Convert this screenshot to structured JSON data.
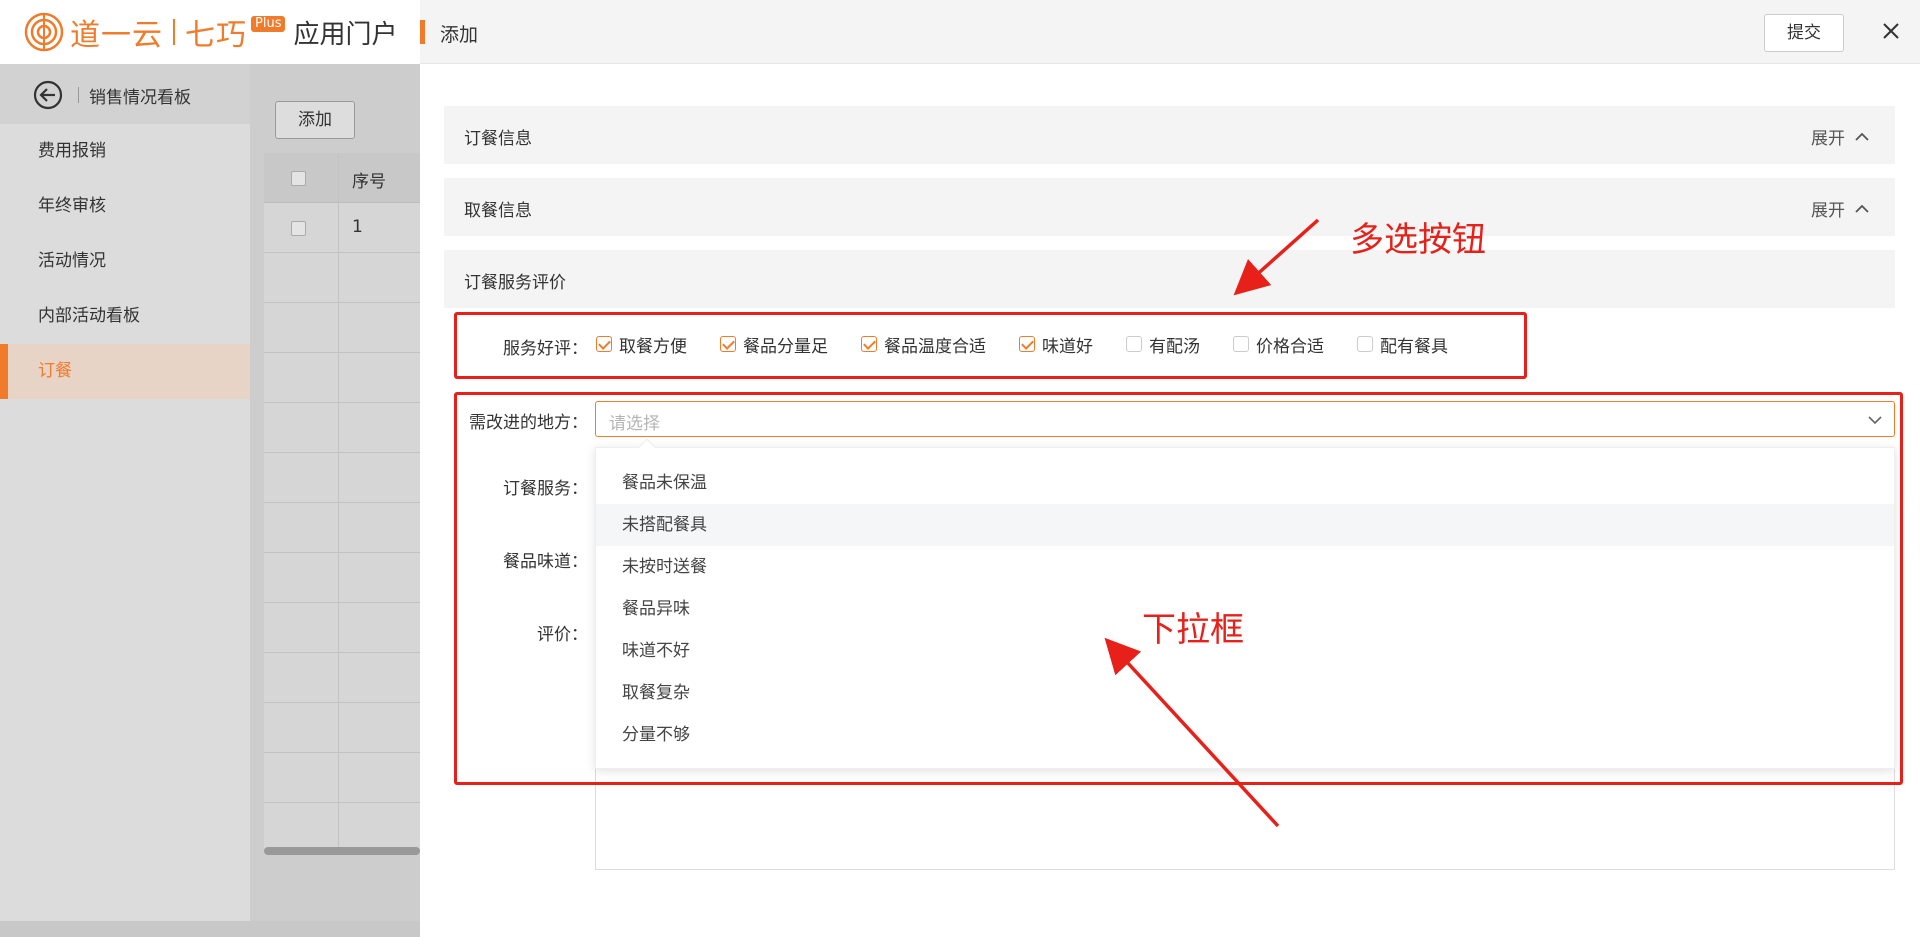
{
  "app": {
    "brand_name": "道一云",
    "brand_sub": "七巧",
    "brand_plus": "Plus",
    "portal_title": "应用门户"
  },
  "sidebar": {
    "header_title": "销售情况看板",
    "items": [
      {
        "label": "费用报销"
      },
      {
        "label": "年终审核"
      },
      {
        "label": "活动情况"
      },
      {
        "label": "内部活动看板"
      },
      {
        "label": "订餐",
        "active": true
      }
    ]
  },
  "main": {
    "add_button": "添加",
    "table": {
      "header_seq": "序号",
      "rows": [
        {
          "seq": "1"
        }
      ]
    }
  },
  "drawer": {
    "title": "添加",
    "submit_button": "提交",
    "sections": [
      {
        "title": "订餐信息",
        "toggle_label": "展开"
      },
      {
        "title": "取餐信息",
        "toggle_label": "展开"
      },
      {
        "title": "订餐服务评价"
      }
    ],
    "form": {
      "praise_label": "服务好评：",
      "praise_options": [
        {
          "label": "取餐方便",
          "checked": true
        },
        {
          "label": "餐品分量足",
          "checked": true
        },
        {
          "label": "餐品温度合适",
          "checked": true
        },
        {
          "label": "味道好",
          "checked": true
        },
        {
          "label": "有配汤",
          "checked": false
        },
        {
          "label": "价格合适",
          "checked": false
        },
        {
          "label": "配有餐具",
          "checked": false
        }
      ],
      "improve_label": "需改进的地方：",
      "improve_placeholder": "请选择",
      "improve_options": [
        {
          "label": "餐品未保温"
        },
        {
          "label": "未搭配餐具",
          "hover": true
        },
        {
          "label": "未按时送餐"
        },
        {
          "label": "餐品异味"
        },
        {
          "label": "味道不好"
        },
        {
          "label": "取餐复杂"
        },
        {
          "label": "分量不够"
        }
      ],
      "service_label": "订餐服务：",
      "taste_label": "餐品味道：",
      "review_label": "评价："
    }
  },
  "annotations": {
    "checkbox_note": "多选按钮",
    "dropdown_note": "下拉框"
  },
  "colors": {
    "accent": "#f07b2b",
    "annotation": "#e7211a"
  }
}
